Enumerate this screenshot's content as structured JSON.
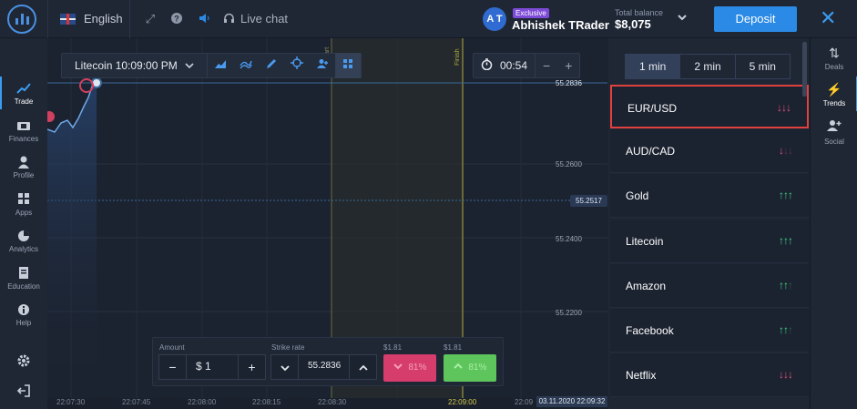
{
  "header": {
    "language": "English",
    "live_chat": "Live chat",
    "avatar_initials": "A T",
    "badge": "Exclusive",
    "username": "Abhishek TRader",
    "balance_label": "Total balance",
    "balance_value": "$8,075",
    "deposit_label": "Deposit"
  },
  "left_nav": [
    "Trade",
    "Finances",
    "Profile",
    "Apps",
    "Analytics",
    "Education",
    "Help"
  ],
  "chart": {
    "asset": "Litecoin 10:09:00 PM",
    "timer": "00:54",
    "price_labels": [
      "55.2836",
      "55.2600",
      "55.2517",
      "55.2400",
      "55.2200"
    ],
    "time_labels": [
      "22:07:30",
      "22:07:45",
      "22:08:00",
      "22:08:15",
      "22:08:30",
      "22:09:00",
      "22:09"
    ],
    "current_time": "03.11.2020 22:09:32",
    "finish_label": "Finish",
    "start_label": "art"
  },
  "trade": {
    "amount_label": "Amount",
    "amount_value": "$ 1",
    "strike_label": "Strike rate",
    "strike_value": "55.2836",
    "put_payout": "$1.81",
    "call_payout": "$1.81",
    "put_pct": "81%",
    "call_pct": "81%"
  },
  "trends": {
    "tabs": [
      "1 min",
      "2 min",
      "5 min"
    ],
    "items": [
      {
        "name": "EUR/USD",
        "dir": "down",
        "strength": 3
      },
      {
        "name": "AUD/CAD",
        "dir": "down",
        "strength": 1
      },
      {
        "name": "Gold",
        "dir": "up",
        "strength": 3
      },
      {
        "name": "Litecoin",
        "dir": "up",
        "strength": 3
      },
      {
        "name": "Amazon",
        "dir": "up",
        "strength": 2
      },
      {
        "name": "Facebook",
        "dir": "up",
        "strength": 2
      },
      {
        "name": "Netflix",
        "dir": "down",
        "strength": 3
      }
    ]
  },
  "right_nav": [
    "Deals",
    "Trends",
    "Social"
  ],
  "colors": {
    "up": "#3ed58a",
    "down": "#e8507e",
    "accent": "#2a8ae6"
  }
}
